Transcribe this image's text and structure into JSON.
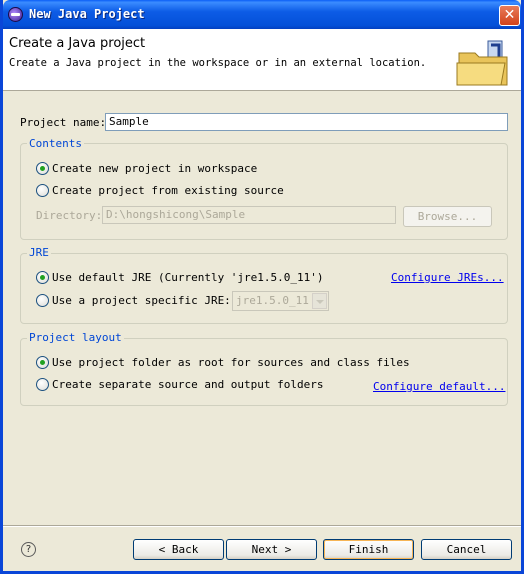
{
  "window": {
    "title": "New Java Project",
    "close_icon": "close-icon"
  },
  "header": {
    "title": "Create a Java project",
    "description": "Create a Java project in the workspace or in an external location.",
    "image_icon": "java-project-folder-icon"
  },
  "project_name": {
    "label": "Project name:",
    "value": "Sample"
  },
  "contents": {
    "title": "Contents",
    "options": [
      {
        "label": "Create new project in workspace",
        "checked": true
      },
      {
        "label": "Create project from existing source",
        "checked": false
      }
    ],
    "directory_label": "Directory:",
    "directory_value": "D:\\hongshicong\\Sample",
    "browse_label": "Browse..."
  },
  "jre": {
    "title": "JRE",
    "options": [
      {
        "label": "Use default JRE (Currently 'jre1.5.0_11')",
        "checked": true
      },
      {
        "label": "Use a project specific JRE:",
        "checked": false
      }
    ],
    "configure_link": "Configure JREs...",
    "combo_value": "jre1.5.0_11"
  },
  "layout": {
    "title": "Project layout",
    "options": [
      {
        "label": "Use project folder as root for sources and class files",
        "checked": true
      },
      {
        "label": "Create separate source and output folders",
        "checked": false
      }
    ],
    "configure_link": "Configure default..."
  },
  "buttons": {
    "back": "< Back",
    "next": "Next >",
    "finish": "Finish",
    "cancel": "Cancel",
    "help": "?"
  },
  "colors": {
    "titlebar": "#0a5ef6",
    "group_title": "#0046d5",
    "link": "#0000ee",
    "dialog_bg": "#ece9d8"
  }
}
